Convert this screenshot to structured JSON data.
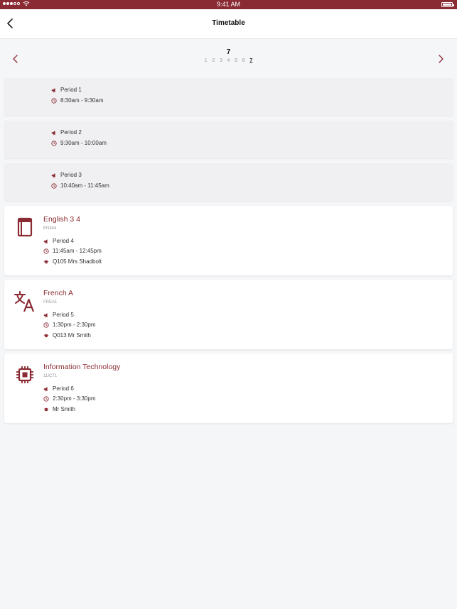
{
  "status_bar": {
    "time": "9:41 AM"
  },
  "header": {
    "title": "Timetable"
  },
  "day_selector": {
    "current_day": "7",
    "days": [
      "1",
      "2",
      "3",
      "4",
      "5",
      "6",
      "7"
    ],
    "active_day": "7"
  },
  "free_periods": [
    {
      "period": "Period 1",
      "time": "8:30am - 9:30am"
    },
    {
      "period": "Period 2",
      "time": "9:30am - 10:00am"
    },
    {
      "period": "Period 3",
      "time": "10:40am - 11:45am"
    }
  ],
  "classes": [
    {
      "name": "English 3 4",
      "code": "EN344",
      "period": "Period 4",
      "time": "11:45am - 12:45pm",
      "location": "Q105 Mrs Shadbolt",
      "icon": "book-icon"
    },
    {
      "name": "French A",
      "code": "FREA1",
      "period": "Period 5",
      "time": "1:30pm - 2:30pm",
      "location": "Q013 Mr Smith",
      "icon": "translate-icon"
    },
    {
      "name": "Information Technology",
      "code": "11ICT1",
      "period": "Period 6",
      "time": "2:30pm - 3:30pm",
      "location": "Mr Smith",
      "icon": "chip-icon"
    }
  ],
  "colors": {
    "accent": "#8a2a32",
    "background": "#f5f6f8"
  }
}
